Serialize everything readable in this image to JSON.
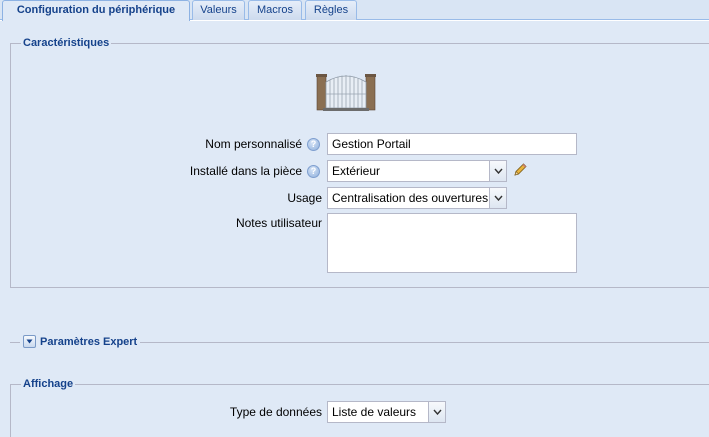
{
  "tabs": [
    {
      "label": "Configuration du périphérique",
      "active": true
    },
    {
      "label": "Valeurs",
      "active": false
    },
    {
      "label": "Macros",
      "active": false
    },
    {
      "label": "Règles",
      "active": false
    }
  ],
  "characteristics": {
    "legend": "Caractéristiques",
    "device_icon": "gate-icon",
    "name_label": "Nom personnalisé",
    "name_value": "Gestion Portail",
    "room_label": "Installé dans la pièce",
    "room_value": "Extérieur",
    "usage_label": "Usage",
    "usage_value": "Centralisation des ouvertures",
    "notes_label": "Notes utilisateur",
    "notes_value": ""
  },
  "expert": {
    "legend": "Paramètres Expert",
    "expanded": false
  },
  "display": {
    "legend": "Affichage",
    "data_type_label": "Type de données",
    "data_type_value": "Liste de valeurs"
  },
  "colors": {
    "legend_text": "#15428b",
    "panel_bg": "#dfe9f6",
    "border": "#b5b8c8"
  }
}
